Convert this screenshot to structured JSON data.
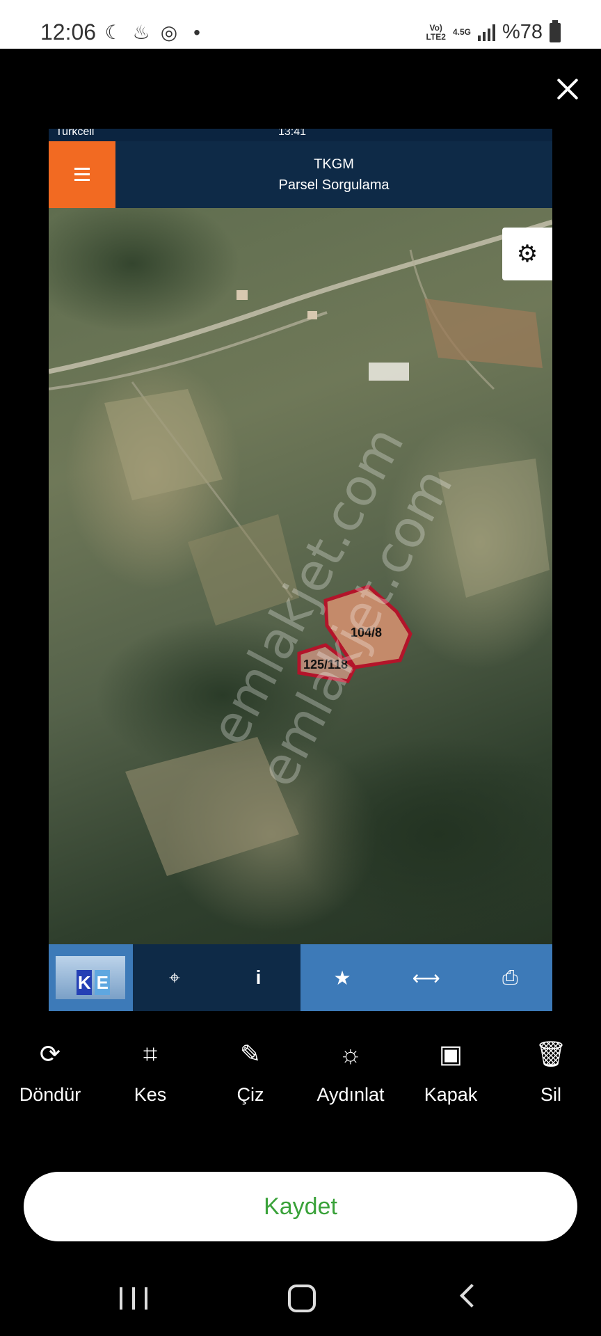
{
  "status_bar": {
    "time": "12:06",
    "network_top": "Vo)",
    "network_bottom": "LTE2",
    "network_speed": "4.5G",
    "battery": "%78"
  },
  "screenshot": {
    "inner_status": {
      "carrier": "Turkcell",
      "clock": "13:41"
    },
    "header": {
      "title": "TKGM",
      "subtitle": "Parsel Sorgulama"
    },
    "parcels": [
      {
        "label": "104/8"
      },
      {
        "label": "125/118"
      }
    ],
    "watermark": [
      "emlakjet.com",
      "emlakjet.com"
    ],
    "logo_letters": {
      "k": "K",
      "e": "E"
    }
  },
  "edit_tools": [
    {
      "label": "Döndür",
      "icon": "rotate-icon"
    },
    {
      "label": "Kes",
      "icon": "crop-icon"
    },
    {
      "label": "Çiz",
      "icon": "brush-icon"
    },
    {
      "label": "Aydınlat",
      "icon": "brightness-icon"
    },
    {
      "label": "Kapak",
      "icon": "cover-image-icon"
    },
    {
      "label": "Sil",
      "icon": "trash-icon"
    }
  ],
  "save_button": "Kaydet",
  "colors": {
    "accent_green": "#3aa23a",
    "menu_orange": "#f26a22",
    "header_navy": "#0e2a47",
    "toolbar_blue": "#3d7ab8"
  }
}
